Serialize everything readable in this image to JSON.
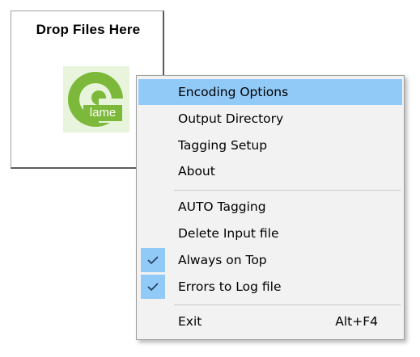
{
  "drop_window": {
    "title": "Drop Files Here",
    "logo_text": "lame",
    "logo_color": "#7cb93a"
  },
  "menu": {
    "highlight_color": "#91c9f7",
    "items": [
      {
        "label": "Encoding Options",
        "highlighted": true
      },
      {
        "label": "Output Directory"
      },
      {
        "label": "Tagging Setup"
      },
      {
        "label": "About"
      },
      {
        "label": "AUTO Tagging"
      },
      {
        "label": "Delete Input file"
      },
      {
        "label": "Always on Top",
        "checked": true
      },
      {
        "label": "Errors to Log file",
        "checked": true
      },
      {
        "label": "Exit",
        "shortcut": "Alt+F4"
      }
    ],
    "check_icon": "checkmark-icon"
  }
}
